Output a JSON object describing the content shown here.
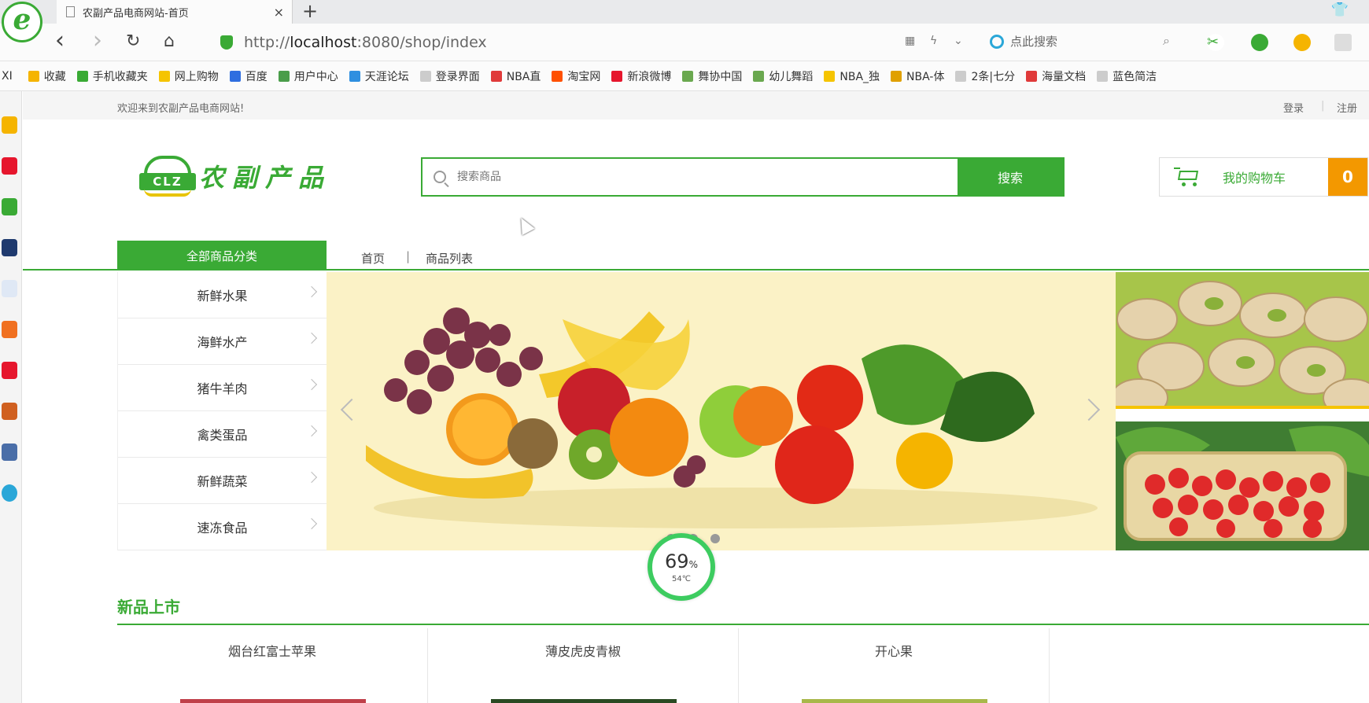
{
  "browser": {
    "logo_letter": "e",
    "tab_title": "农副产品电商网站-首页",
    "tab_close": "×",
    "new_tab": "+",
    "skin_icon": "👕",
    "nav": {
      "back": "‹",
      "forward": "›",
      "refresh": "↻",
      "home": "⌂"
    },
    "url_prefix": "http://",
    "url_host": "localhost",
    "url_rest": ":8080/shop/index",
    "search_placeholder": "点此搜索",
    "bookmarks": [
      {
        "label": "收藏",
        "color": "#f5b400"
      },
      {
        "label": "手机收藏夹",
        "color": "#3aaa35"
      },
      {
        "label": "网上购物",
        "color": "#f5c400"
      },
      {
        "label": "百度",
        "color": "#2f6ee0"
      },
      {
        "label": "用户中心",
        "color": "#4a9d4a"
      },
      {
        "label": "天涯论坛",
        "color": "#2f8fe0"
      },
      {
        "label": "登录界面",
        "color": "#cccccc"
      },
      {
        "label": "NBA直",
        "color": "#e03a3a"
      },
      {
        "label": "淘宝网",
        "color": "#ff5000"
      },
      {
        "label": "新浪微博",
        "color": "#e6162d"
      },
      {
        "label": "舞协中国",
        "color": "#6aa84f"
      },
      {
        "label": "幼儿舞蹈",
        "color": "#6aa84f"
      },
      {
        "label": "NBA_独",
        "color": "#f5c400"
      },
      {
        "label": "NBA-体",
        "color": "#e0a000"
      },
      {
        "label": "2条|七分",
        "color": "#cccccc"
      },
      {
        "label": "海量文档",
        "color": "#e03a3a"
      },
      {
        "label": "蓝色简洁",
        "color": "#cccccc"
      }
    ],
    "accent_color": "#3aaa35"
  },
  "site": {
    "welcome": "欢迎来到农副产品电商网站!",
    "login": "登录",
    "register": "注册",
    "logo_badge": "CLZ",
    "logo_text": "农副产品",
    "search_placeholder": "搜索商品",
    "search_button": "搜索",
    "cart_label": "我的购物车",
    "cart_count": "0",
    "nav_all_categories": "全部商品分类",
    "nav_home": "首页",
    "nav_separator": "|",
    "nav_product_list": "商品列表",
    "categories": [
      "新鲜水果",
      "海鲜水产",
      "猪牛羊肉",
      "禽类蛋品",
      "新鲜蔬菜",
      "速冻食品"
    ],
    "new_arrivals_title": "新品上市",
    "products": [
      "烟台红富士苹果",
      "薄皮虎皮青椒",
      "开心果",
      ""
    ],
    "brand_color": "#3aaa35",
    "cart_badge_color": "#f39800"
  },
  "overlay": {
    "temp_percent": "69",
    "percent_sign": "%",
    "temp_celsius": "54℃"
  }
}
